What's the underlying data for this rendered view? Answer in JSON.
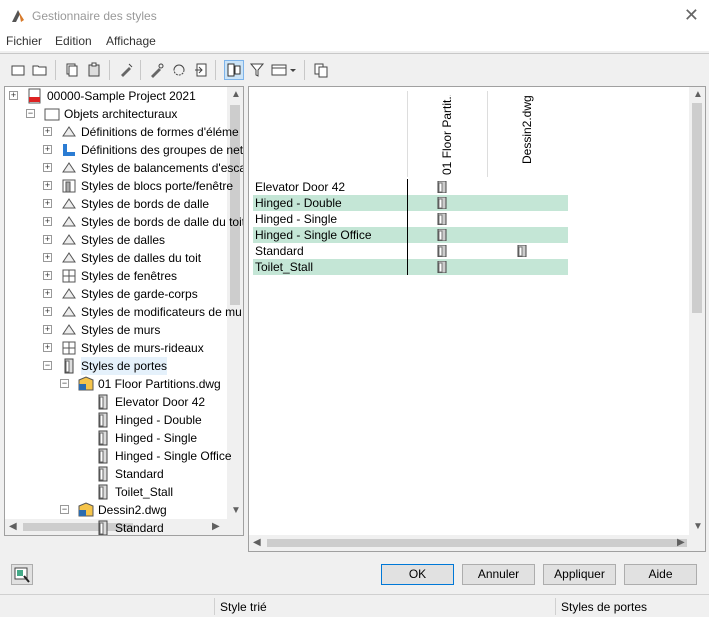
{
  "window": {
    "title": "Gestionnaire des styles"
  },
  "menu": [
    "Fichier",
    "Edition",
    "Affichage"
  ],
  "toolbar": {
    "icons": [
      "new-icon",
      "open-icon",
      "copy-icon",
      "paste-icon",
      "purge-icon",
      "edit-icon",
      "sync-icon",
      "import-icon",
      "view-toggle-icon",
      "filter-icon",
      "view-mode-icon",
      "export-icon"
    ]
  },
  "tree": {
    "items": [
      {
        "label": "00000-Sample Project 2021",
        "icon": "project-icon"
      },
      {
        "label": "Objets architecturaux",
        "icon": "folder-icon"
      },
      {
        "label": "Définitions de formes d'éléme",
        "icon": "shape-icon"
      },
      {
        "label": "Définitions des groupes de net",
        "icon": "group-icon"
      },
      {
        "label": "Styles de balancements d'esca",
        "icon": "stair-icon"
      },
      {
        "label": "Styles de blocs porte/fenêtre",
        "icon": "door-window-icon"
      },
      {
        "label": "Styles de bords de dalle",
        "icon": "slab-edge-icon"
      },
      {
        "label": "Styles de bords de dalle du toit",
        "icon": "roof-edge-icon"
      },
      {
        "label": "Styles de dalles",
        "icon": "slab-icon"
      },
      {
        "label": "Styles de dalles du toit",
        "icon": "roof-slab-icon"
      },
      {
        "label": "Styles de fenêtres",
        "icon": "window-icon"
      },
      {
        "label": "Styles de garde-corps",
        "icon": "railing-icon"
      },
      {
        "label": "Styles de modificateurs de mu",
        "icon": "wall-modifier-icon"
      },
      {
        "label": "Styles de murs",
        "icon": "wall-icon"
      },
      {
        "label": "Styles de murs-rideaux",
        "icon": "curtain-wall-icon"
      },
      {
        "label": "Styles de portes",
        "icon": "door-icon"
      },
      {
        "label": "01 Floor Partitions.dwg",
        "icon": "drawing-icon"
      },
      {
        "label": "Elevator Door 42",
        "icon": "door-icon"
      },
      {
        "label": "Hinged - Double",
        "icon": "door-icon"
      },
      {
        "label": "Hinged - Single",
        "icon": "door-icon"
      },
      {
        "label": "Hinged - Single Office",
        "icon": "door-icon"
      },
      {
        "label": "Standard",
        "icon": "door-icon"
      },
      {
        "label": "Toilet_Stall",
        "icon": "door-icon"
      },
      {
        "label": "Dessin2.dwg",
        "icon": "drawing-icon"
      },
      {
        "label": "Standard",
        "icon": "door-icon"
      }
    ]
  },
  "grid": {
    "columns": [
      "01 Floor Partit...",
      "Dessin2.dwg"
    ],
    "rows": [
      {
        "label": "Elevator Door 42",
        "in": [
          true,
          false
        ]
      },
      {
        "label": "Hinged - Double",
        "in": [
          true,
          false
        ]
      },
      {
        "label": "Hinged - Single",
        "in": [
          true,
          false
        ]
      },
      {
        "label": "Hinged - Single Office",
        "in": [
          true,
          false
        ]
      },
      {
        "label": "Standard",
        "in": [
          true,
          true
        ]
      },
      {
        "label": "Toilet_Stall",
        "in": [
          true,
          false
        ]
      }
    ]
  },
  "buttons": {
    "ok": "OK",
    "cancel": "Annuler",
    "apply": "Appliquer",
    "help": "Aide"
  },
  "status": {
    "left": "Style trié",
    "right": "Styles de portes"
  }
}
